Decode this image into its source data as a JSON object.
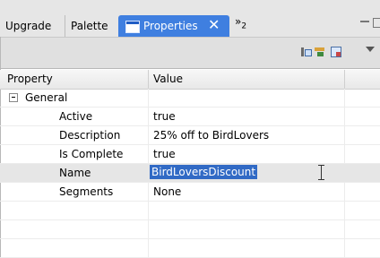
{
  "tabs": {
    "upgrade": "Upgrade",
    "palette": "Palette",
    "properties": "Properties",
    "close_symbol": "✕",
    "overflow_chevron": "»",
    "overflow_count": "2"
  },
  "table": {
    "headers": {
      "property": "Property",
      "value": "Value"
    },
    "group": {
      "label": "General",
      "expander": "collapse-toggle-icon"
    },
    "rows": [
      {
        "property": "Active",
        "value": "true"
      },
      {
        "property": "Description",
        "value": "25% off to BirdLovers"
      },
      {
        "property": "Is Complete",
        "value": "true"
      },
      {
        "property": "Name",
        "value": "BirdLoversDiscount",
        "editing": true
      },
      {
        "property": "Segments",
        "value": "None"
      }
    ]
  },
  "toolbar": {
    "icons": [
      "show-categories-icon",
      "show-advanced-icon",
      "restore-default-icon",
      "view-menu-icon"
    ]
  },
  "colors": {
    "active_tab": "#3f7fe0",
    "selection": "#316ac5",
    "selected_row": "#e6e6e6"
  }
}
